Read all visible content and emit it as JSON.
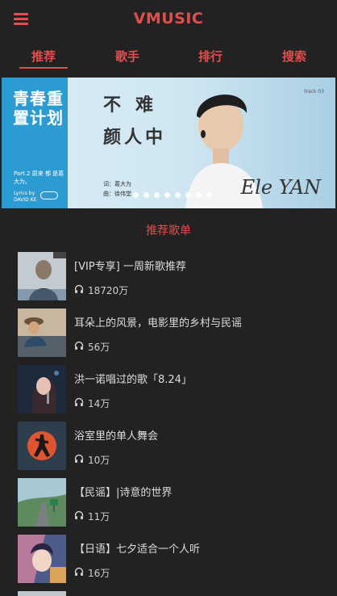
{
  "header": {
    "title": "VMUSIC"
  },
  "tabs": [
    {
      "label": "推荐",
      "active": true
    },
    {
      "label": "歌手",
      "active": false
    },
    {
      "label": "排行",
      "active": false
    },
    {
      "label": "搜索",
      "active": false
    }
  ],
  "banner": {
    "cover_title": "青春重置计划",
    "cover_sub": "Part.2 原来 都 是葛大为。",
    "cover_lyric": "Lyrics by DAVID KE",
    "text_line1": "不难",
    "text_line2": "颜人中",
    "credit_line1": "词：葛大为",
    "credit_line2": "曲：徐伟堂",
    "track": "track 03",
    "artist": "Ele YAN",
    "dot_count": 8
  },
  "section_title": "推荐歌单",
  "playlists": [
    {
      "title": "[VIP专享] 一周新歌推荐",
      "count": "18720万",
      "thumb_label": "一周新歌推荐",
      "thumb_color": "#aeb9c2"
    },
    {
      "title": "耳朵上的风景，电影里的乡村与民谣",
      "count": "56万",
      "thumb_color": "#8a6e52"
    },
    {
      "title": "洪一诺唱过的歌「8.24」",
      "count": "14万",
      "thumb_color": "#22303f"
    },
    {
      "title": "浴室里的单人舞会",
      "count": "10万",
      "thumb_color": "#2f3e4d"
    },
    {
      "title": "【民谣】|诗意的世界",
      "count": "11万",
      "thumb_color": "#7aa38a"
    },
    {
      "title": "【日语】七夕适合一个人听",
      "count": "16万",
      "thumb_color": "#5a5e8c"
    }
  ],
  "colors": {
    "accent": "#e54c4c",
    "background": "#222222"
  }
}
